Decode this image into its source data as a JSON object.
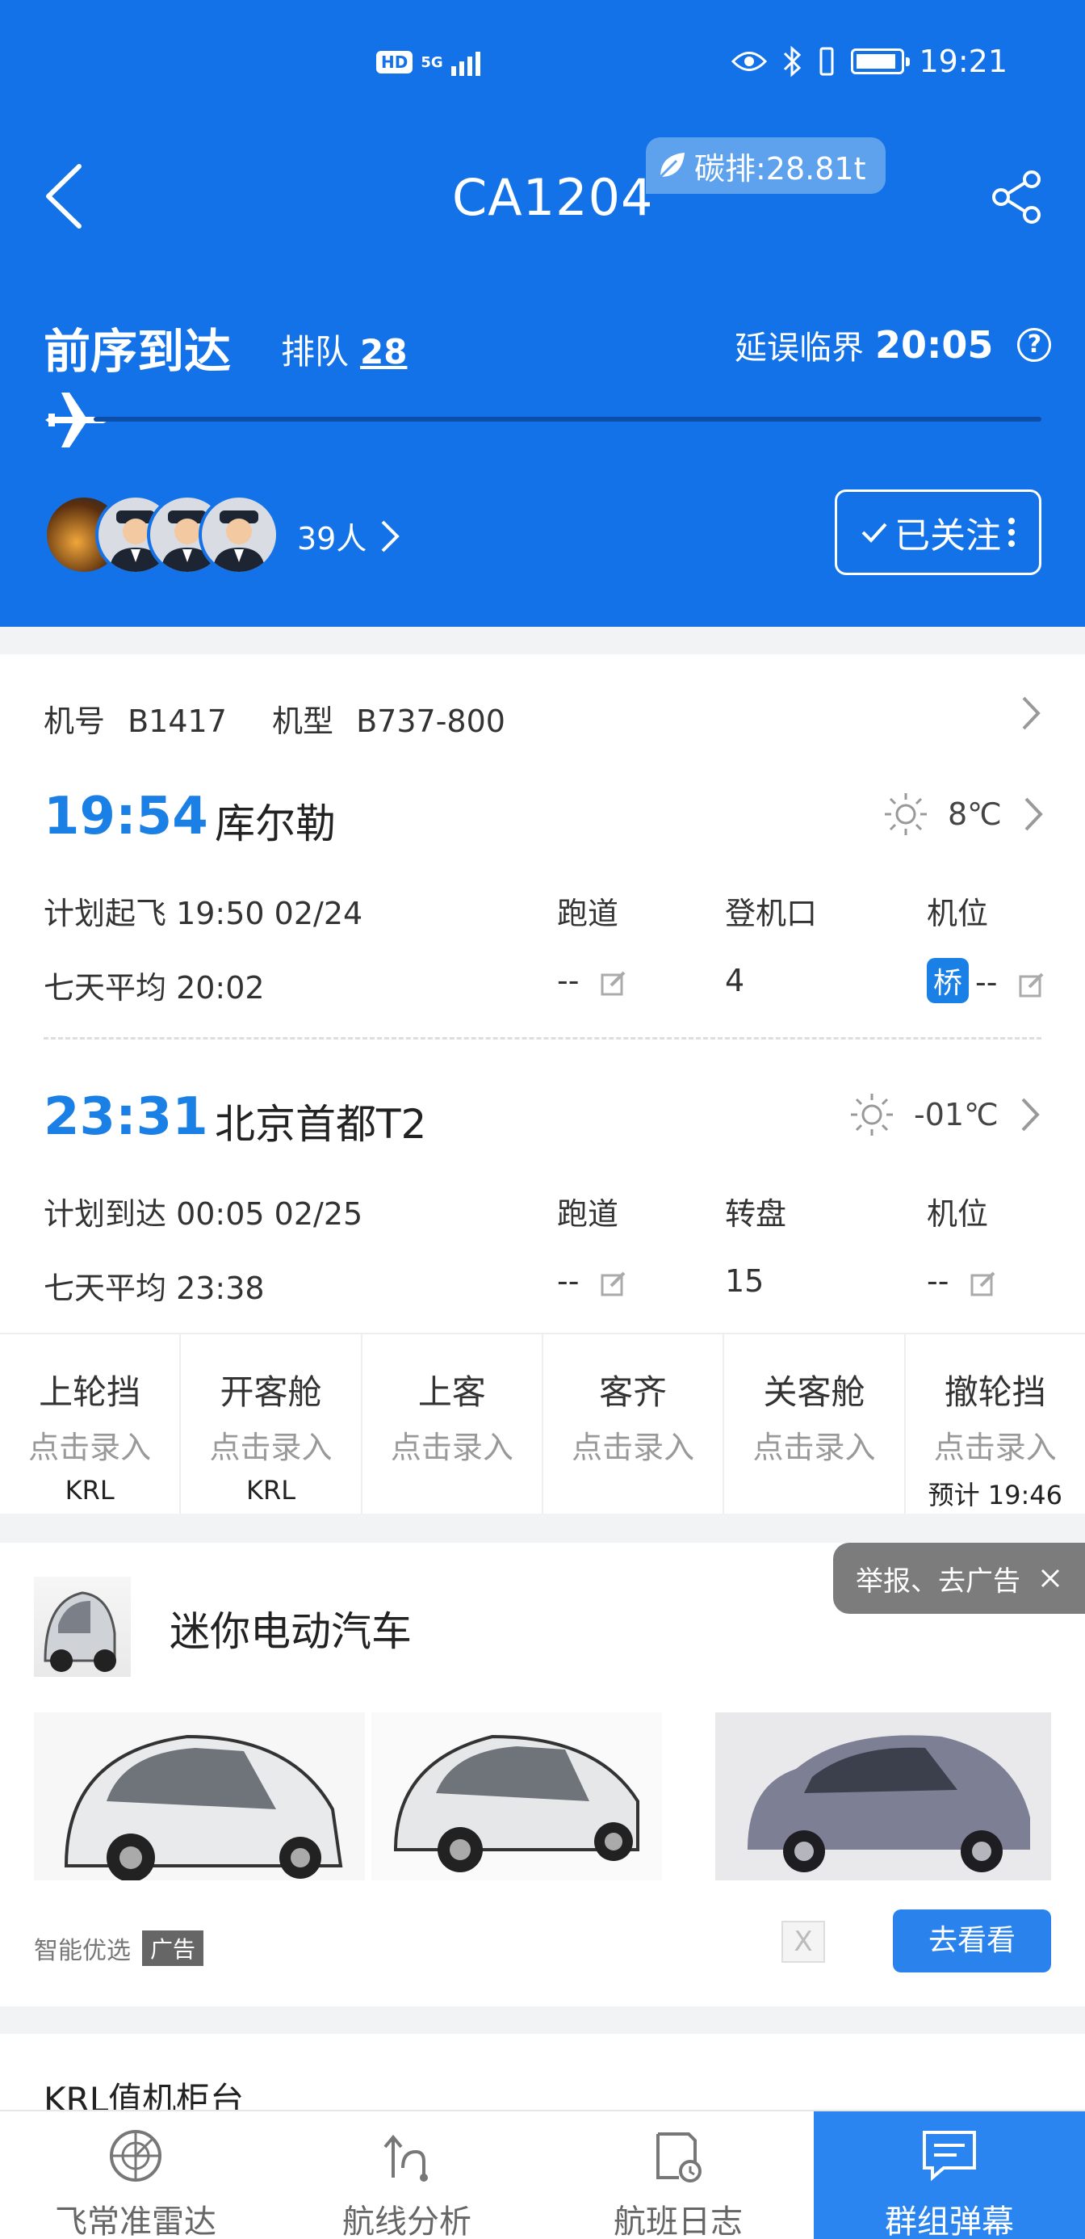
{
  "status_bar": {
    "time": "19:21",
    "hd": "HD",
    "net": "5G"
  },
  "header": {
    "flight_no": "CA1204",
    "carbon": "碳排:28.81t",
    "status": "前序到达",
    "queue_label": "排队",
    "queue_value": "28",
    "delay_label": "延误临界",
    "delay_time": "20:05",
    "followers": "39人",
    "follow_label": "已关注"
  },
  "aircraft": {
    "reg_label": "机号",
    "reg": "B1417",
    "type_label": "机型",
    "type": "B737-800"
  },
  "departure": {
    "time": "19:54",
    "city": "库尔勒",
    "temp": "8℃",
    "plan_label": "计划起飞 19:50 02/24",
    "avg_label": "七天平均 20:02",
    "col1_label": "跑道",
    "col2_label": "登机口",
    "col3_label": "机位",
    "col1_value": "--",
    "col2_value": "4",
    "bridge": "桥",
    "col3_value": "--"
  },
  "arrival": {
    "time": "23:31",
    "city": "北京首都T2",
    "temp": "-01℃",
    "plan_label": "计划到达 00:05 02/25",
    "avg_label": "七天平均 23:38",
    "col1_label": "跑道",
    "col2_label": "转盘",
    "col3_label": "机位",
    "col1_value": "--",
    "col2_value": "15",
    "col3_value": "--"
  },
  "steps": [
    {
      "title": "上轮挡",
      "sub": "点击录入",
      "note": "KRL"
    },
    {
      "title": "开客舱",
      "sub": "点击录入",
      "note": "KRL"
    },
    {
      "title": "上客",
      "sub": "点击录入",
      "note": ""
    },
    {
      "title": "客齐",
      "sub": "点击录入",
      "note": ""
    },
    {
      "title": "关客舱",
      "sub": "点击录入",
      "note": ""
    },
    {
      "title": "撤轮挡",
      "sub": "点击录入",
      "note": "预计 19:46"
    }
  ],
  "ad": {
    "report": "举报、去广告",
    "title": "迷你电动汽车",
    "source": "智能优选",
    "tag": "广告",
    "close": "X",
    "cta": "去看看"
  },
  "checkin": {
    "title": "KRL值机柜台"
  },
  "nav": [
    {
      "label": "飞常准雷达",
      "icon": "radar-icon"
    },
    {
      "label": "航线分析",
      "icon": "route-icon"
    },
    {
      "label": "航班日志",
      "icon": "log-icon"
    },
    {
      "label": "群组弹幕",
      "icon": "chat-icon"
    }
  ],
  "colors": {
    "primary": "#1472e8",
    "accent": "#1b80e6",
    "active_nav": "#2b85f0"
  }
}
